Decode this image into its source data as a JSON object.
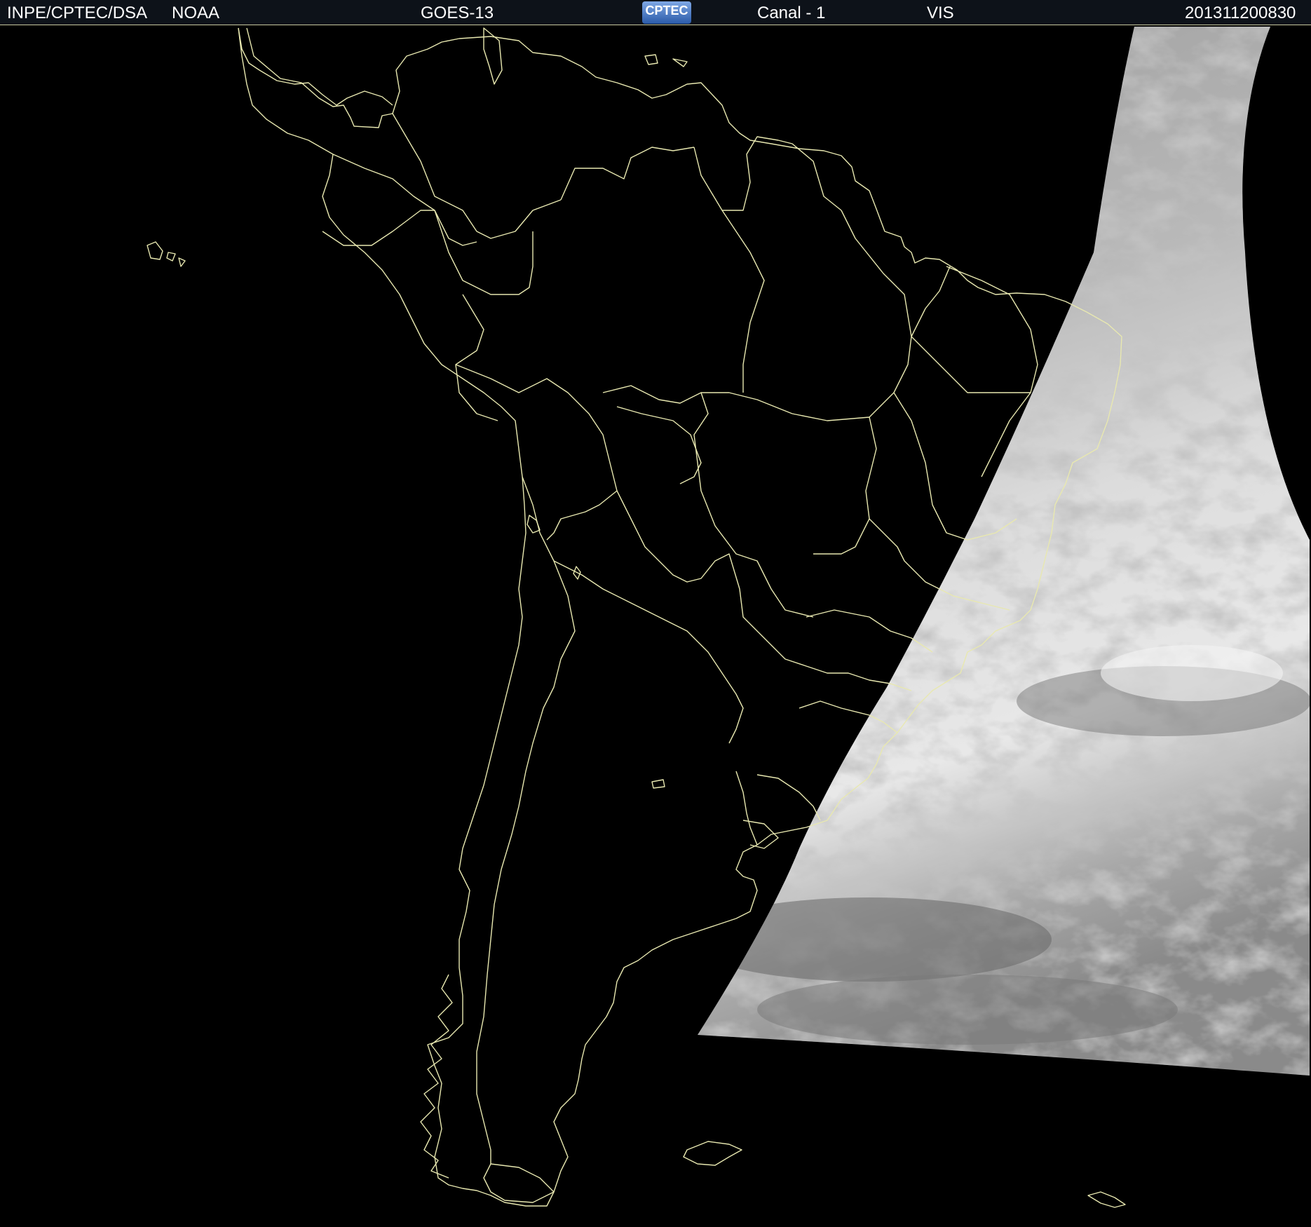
{
  "header": {
    "org": "INPE/CPTEC/DSA",
    "agency": "NOAA",
    "satellite": "GOES-13",
    "logo_text": "CPTEC",
    "channel": "Canal - 1",
    "band": "VIS",
    "timestamp": "201311200830"
  },
  "colors": {
    "header_bg": "#0d1219",
    "map_bg": "#000000",
    "borders": "#e8e8b0",
    "clouds_light": "#e9e9e9",
    "clouds_mid": "#9a9a9a",
    "clouds_dark": "#6a6a6a"
  }
}
